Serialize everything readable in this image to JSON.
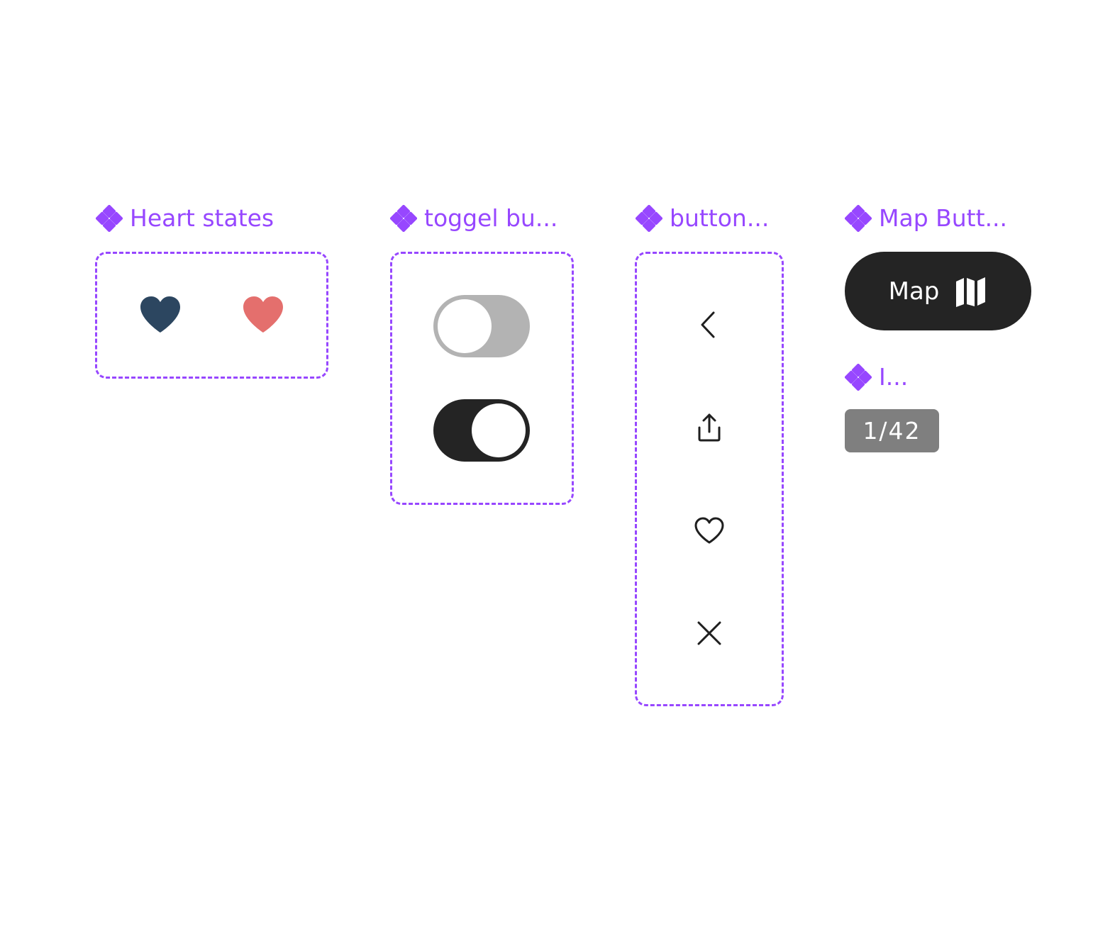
{
  "colors": {
    "component_purple": "#9747ff",
    "heart_dark": "#2c4660",
    "heart_coral": "#e46f6d",
    "toggle_off_track": "#b3b3b3",
    "toggle_on_track": "#242424",
    "dark_button": "#242424",
    "counter_bg": "#7f7f7f",
    "icon_stroke": "#1f1f1f"
  },
  "components": {
    "heart_states": {
      "label": "Heart states",
      "icon": "component-icon",
      "variants": [
        {
          "name": "heart-filled-dark",
          "icon": "heart-filled-icon",
          "color": "#2c4660"
        },
        {
          "name": "heart-filled-coral",
          "icon": "heart-filled-icon",
          "color": "#e46f6d"
        }
      ]
    },
    "toggle_button": {
      "label": "toggel bu...",
      "icon": "component-icon",
      "variants": [
        {
          "state": "off",
          "track_color": "#b3b3b3"
        },
        {
          "state": "on",
          "track_color": "#242424"
        }
      ]
    },
    "button_icons": {
      "label": "button...",
      "icon": "component-icon",
      "items": [
        "chevron-left-icon",
        "share-icon",
        "heart-outline-icon",
        "close-icon"
      ]
    },
    "map_button": {
      "label": "Map Butt...",
      "icon": "component-icon",
      "button_label": "Map",
      "button_icon": "map-icon"
    },
    "image_counter": {
      "label": "I...",
      "icon": "component-icon",
      "value": "1/42"
    }
  }
}
